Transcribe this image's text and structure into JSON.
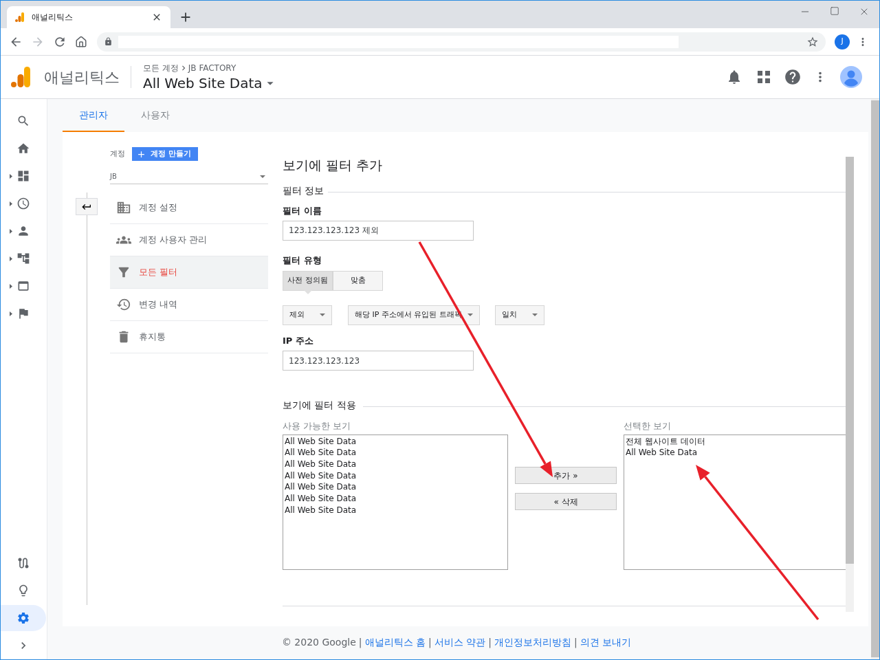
{
  "browser": {
    "tab_title": "애널리틱스",
    "avatar_letter": "J"
  },
  "header": {
    "product": "애널리틱스",
    "breadcrumb": [
      "모든 계정",
      "JB FACTORY"
    ],
    "view": "All Web Site Data"
  },
  "rail": [
    {
      "kind": "search",
      "expandable": false,
      "selected": false
    },
    {
      "kind": "home",
      "expandable": false,
      "selected": false
    },
    {
      "kind": "dashboard",
      "expandable": true,
      "selected": false
    },
    {
      "kind": "clock",
      "expandable": true,
      "selected": false
    },
    {
      "kind": "person",
      "expandable": true,
      "selected": false
    },
    {
      "kind": "acquisition",
      "expandable": true,
      "selected": false
    },
    {
      "kind": "behavior",
      "expandable": true,
      "selected": false
    },
    {
      "kind": "flag",
      "expandable": true,
      "selected": false
    }
  ],
  "rail_bottom": [
    {
      "kind": "path",
      "selected": false
    },
    {
      "kind": "bulb",
      "selected": false
    },
    {
      "kind": "settings",
      "selected": true
    },
    {
      "kind": "expand",
      "selected": false
    }
  ],
  "tabs": [
    {
      "label": "관리자",
      "selected": true
    },
    {
      "label": "사용자",
      "selected": false
    }
  ],
  "account": {
    "label": "계정",
    "create_button": "계정 만들기",
    "selector": "JB"
  },
  "menu": [
    {
      "label": "계정 설정",
      "kind": "building",
      "selected": false
    },
    {
      "label": "계정 사용자 관리",
      "kind": "people",
      "selected": false
    },
    {
      "label": "모든 필터",
      "kind": "filter",
      "selected": true
    },
    {
      "label": "변경 내역",
      "kind": "history",
      "selected": false
    },
    {
      "label": "휴지통",
      "kind": "trash",
      "selected": false
    }
  ],
  "form": {
    "title": "보기에 필터 추가",
    "info_section": "필터 정보",
    "name_label": "필터 이름",
    "name_value": "123.123.123.123 제외",
    "type_label": "필터 유형",
    "type_tabs": [
      {
        "label": "사전 정의됨",
        "selected": true
      },
      {
        "label": "맞춤",
        "selected": false
      }
    ],
    "dropdowns": [
      "제외",
      "해당 IP 주소에서 유입된 트래픽",
      "일치"
    ],
    "ip_label": "IP 주소",
    "ip_value": "123.123.123.123",
    "apply_section": "보기에 필터 적용",
    "available_label": "사용 가능한 보기",
    "available": [
      "All Web Site Data",
      "All Web Site Data",
      "All Web Site Data",
      "All Web Site Data",
      "All Web Site Data",
      "All Web Site Data",
      "All Web Site Data"
    ],
    "add_button": "추가 »",
    "remove_button": "« 삭제",
    "selected_label": "선택한 보기",
    "selected_views": [
      "전체 웹사이트 데이터",
      "All Web Site Data"
    ]
  },
  "footer": {
    "copyright": "© 2020 Google",
    "links": [
      {
        "separator": "|",
        "label": "애널리틱스 홈"
      },
      {
        "separator": "|",
        "label": "서비스 약관"
      },
      {
        "separator": "|",
        "label": "개인정보처리방침"
      },
      {
        "separator": "|",
        "label": "의견 보내기"
      }
    ]
  }
}
